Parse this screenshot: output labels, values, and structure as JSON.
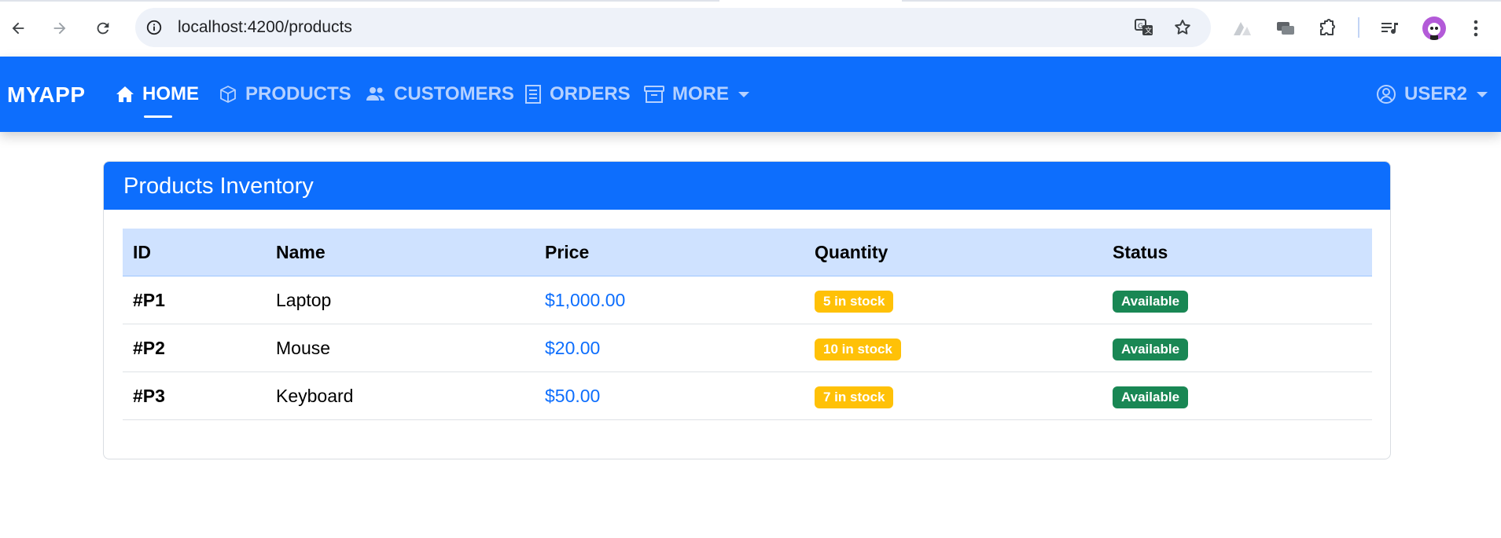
{
  "browser": {
    "url": "localhost:4200/products"
  },
  "navbar": {
    "brand": "MYAPP",
    "items": [
      {
        "label": "HOME",
        "icon": "home-icon",
        "active": true
      },
      {
        "label": "PRODUCTS",
        "icon": "box-icon",
        "active": false
      },
      {
        "label": "CUSTOMERS",
        "icon": "users-icon",
        "active": false
      },
      {
        "label": "ORDERS",
        "icon": "receipt-icon",
        "active": false
      },
      {
        "label": "MORE",
        "icon": "archive-icon",
        "active": false,
        "dropdown": true
      }
    ],
    "user": {
      "label": "USER2",
      "icon": "user-circle-icon",
      "dropdown": true
    }
  },
  "card": {
    "title": "Products Inventory",
    "columns": [
      "ID",
      "Name",
      "Price",
      "Quantity",
      "Status"
    ],
    "rows": [
      {
        "id": "#P1",
        "name": "Laptop",
        "price": "$1,000.00",
        "quantity": "5 in stock",
        "status": "Available"
      },
      {
        "id": "#P2",
        "name": "Mouse",
        "price": "$20.00",
        "quantity": "10 in stock",
        "status": "Available"
      },
      {
        "id": "#P3",
        "name": "Keyboard",
        "price": "$50.00",
        "quantity": "7 in stock",
        "status": "Available"
      }
    ]
  },
  "colors": {
    "primary": "#0d6efd",
    "table_header": "#cfe2ff",
    "stock_badge": "#ffc107",
    "status_badge": "#198754",
    "nav_inactive": "#b5d1ff"
  }
}
